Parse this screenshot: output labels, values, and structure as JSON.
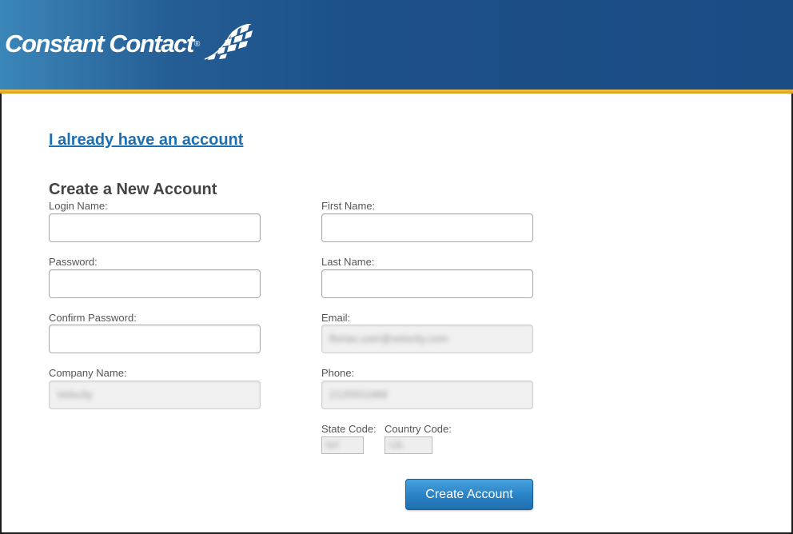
{
  "header": {
    "logo_text": "Constant Contact",
    "logo_registered": "®",
    "logo_mark_icon": "checkered-flag-icon",
    "brand_color": "#1c4c84",
    "stripe_color": "#e9b233"
  },
  "links": {
    "existing_account": "I already have an account"
  },
  "form": {
    "title": "Create a New Account",
    "login_name": {
      "label": "Login Name:",
      "value": ""
    },
    "password": {
      "label": "Password:",
      "value": ""
    },
    "confirm_password": {
      "label": "Confirm Password:",
      "value": ""
    },
    "company_name": {
      "label": "Company Name:",
      "value": "Velocity"
    },
    "first_name": {
      "label": "First Name:",
      "value": ""
    },
    "last_name": {
      "label": "Last Name:",
      "value": ""
    },
    "email": {
      "label": "Email:",
      "value": "florian.user@velocity.com"
    },
    "phone": {
      "label": "Phone:",
      "value": "2125551989"
    },
    "state_code": {
      "label": "State Code:",
      "value": "NY"
    },
    "country_code": {
      "label": "Country Code:",
      "value": "US"
    },
    "submit_label": "Create Account",
    "button_color": "#2b84c7",
    "link_color": "#1d6fb3"
  }
}
